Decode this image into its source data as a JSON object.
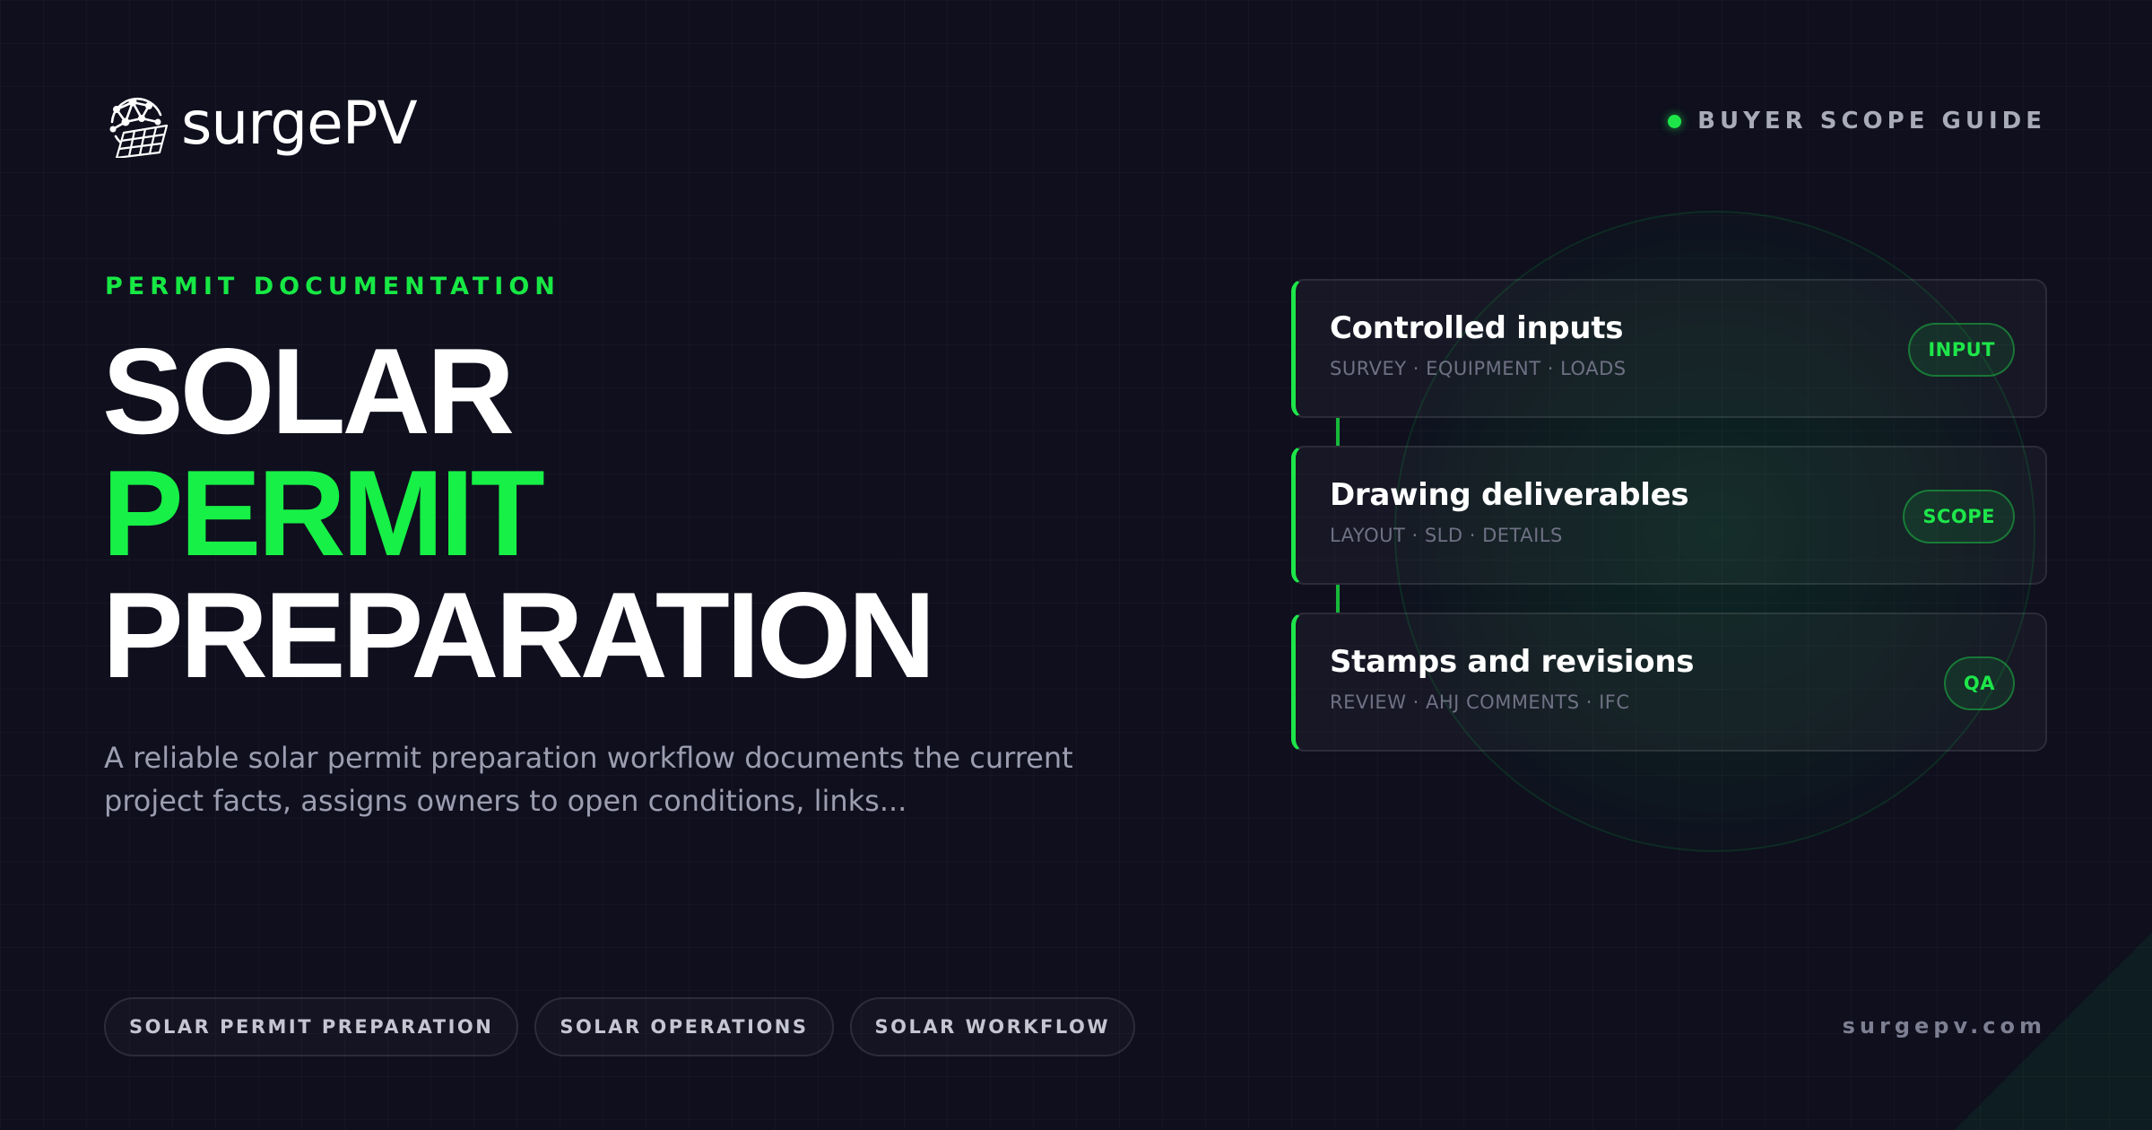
{
  "brand": {
    "logo_text": "surgePV",
    "logo_icon": "solar-globe-icon",
    "domain": "surgepv.com"
  },
  "header": {
    "guide_label": "BUYER SCOPE GUIDE"
  },
  "hero": {
    "eyebrow": "PERMIT DOCUMENTATION",
    "title_line_1": "SOLAR",
    "title_line_2": "PERMIT",
    "title_line_3": "PREPARATION",
    "description": "A reliable solar permit preparation workflow documents the current project facts, assigns owners to open conditions, links..."
  },
  "tags": [
    "SOLAR PERMIT PREPARATION",
    "SOLAR OPERATIONS",
    "SOLAR WORKFLOW"
  ],
  "cards": [
    {
      "title": "Controlled inputs",
      "subtitle": "SURVEY · EQUIPMENT · LOADS",
      "badge": "INPUT"
    },
    {
      "title": "Drawing deliverables",
      "subtitle": "LAYOUT · SLD · DETAILS",
      "badge": "SCOPE"
    },
    {
      "title": "Stamps and revisions",
      "subtitle": "REVIEW · AHJ COMMENTS · IFC",
      "badge": "QA"
    }
  ],
  "colors": {
    "background": "#0f0f1e",
    "accent": "#17f046",
    "muted_text": "#9c9eb0"
  }
}
